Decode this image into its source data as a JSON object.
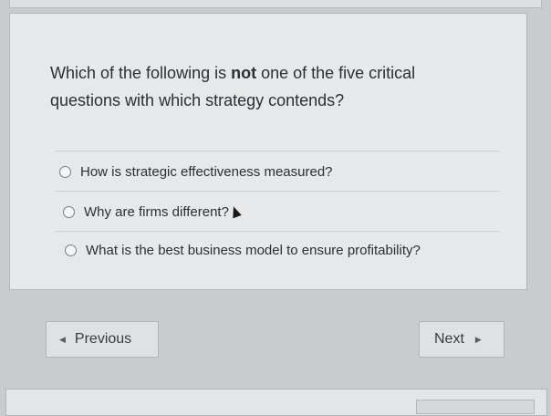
{
  "question": {
    "text_before": "Which of the following is ",
    "emphasis": "not",
    "text_after": " one of the five critical questions with which strategy contends?"
  },
  "options": [
    {
      "label": "How is strategic effectiveness measured?",
      "selected": false
    },
    {
      "label": "Why are firms different?",
      "selected": false
    },
    {
      "label": "What is the best business model to ensure profitability?",
      "selected": false
    }
  ],
  "nav": {
    "previous_label": "Previous",
    "next_label": "Next"
  }
}
